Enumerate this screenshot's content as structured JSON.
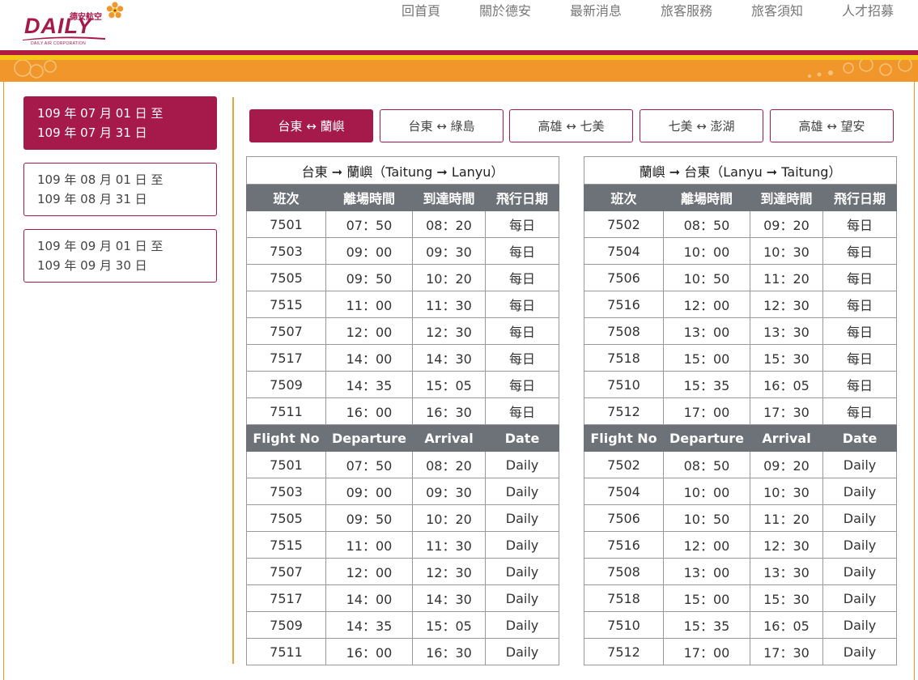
{
  "brand": {
    "chinese_name": "德安航空",
    "wordmark": "DAILY",
    "subtitle": "DAILY AIR CORPORATION"
  },
  "nav": [
    "回首頁",
    "關於德安",
    "最新消息",
    "旅客服務",
    "旅客須知",
    "人才招募"
  ],
  "periods": [
    {
      "line1": "109 年 07 月 01 日 至",
      "line2": "109 年 07 月 31 日",
      "active": true
    },
    {
      "line1": "109 年 08 月 01 日 至",
      "line2": "109 年 08 月 31 日",
      "active": false
    },
    {
      "line1": "109 年 09 月 01 日 至",
      "line2": "109 年 09 月 30 日",
      "active": false
    }
  ],
  "routes": [
    {
      "label": "台東 ↔ 蘭嶼",
      "active": true
    },
    {
      "label": "台東 ↔ 綠島",
      "active": false
    },
    {
      "label": "高雄 ↔ 七美",
      "active": false
    },
    {
      "label": "七美 ↔ 澎湖",
      "active": false
    },
    {
      "label": "高雄 ↔ 望安",
      "active": false
    }
  ],
  "tables": [
    {
      "caption": "台東 ➞ 蘭嶼（Taitung ➞ Lanyu）",
      "headers_zh": [
        "班次",
        "離場時間",
        "到達時間",
        "飛行日期"
      ],
      "headers_en": [
        "Flight No",
        "Departure",
        "Arrival",
        "Date"
      ],
      "rows": [
        [
          "7501",
          "07：50",
          "08：20"
        ],
        [
          "7503",
          "09：00",
          "09：30"
        ],
        [
          "7505",
          "09：50",
          "10：20"
        ],
        [
          "7515",
          "11：00",
          "11：30"
        ],
        [
          "7507",
          "12：00",
          "12：30"
        ],
        [
          "7517",
          "14：00",
          "14：30"
        ],
        [
          "7509",
          "14：35",
          "15：05"
        ],
        [
          "7511",
          "16：00",
          "16：30"
        ]
      ],
      "date_zh": "每日",
      "date_en": "Daily"
    },
    {
      "caption": "蘭嶼 ➞ 台東（Lanyu ➞ Taitung）",
      "headers_zh": [
        "班次",
        "離場時間",
        "到達時間",
        "飛行日期"
      ],
      "headers_en": [
        "Flight No",
        "Departure",
        "Arrival",
        "Date"
      ],
      "rows": [
        [
          "7502",
          "08：50",
          "09：20"
        ],
        [
          "7504",
          "10：00",
          "10：30"
        ],
        [
          "7506",
          "10：50",
          "11：20"
        ],
        [
          "7516",
          "12：00",
          "12：30"
        ],
        [
          "7508",
          "13：00",
          "13：30"
        ],
        [
          "7518",
          "15：00",
          "15：30"
        ],
        [
          "7510",
          "15：35",
          "16：05"
        ],
        [
          "7512",
          "17：00",
          "17：30"
        ]
      ],
      "date_zh": "每日",
      "date_en": "Daily"
    }
  ],
  "colors": {
    "brand": "#a6194b",
    "header_gray": "#6d7178",
    "stripe_red": "#b01c3e",
    "stripe_yellow": "#f7c51a",
    "stripe_orange": "#f1962b"
  }
}
